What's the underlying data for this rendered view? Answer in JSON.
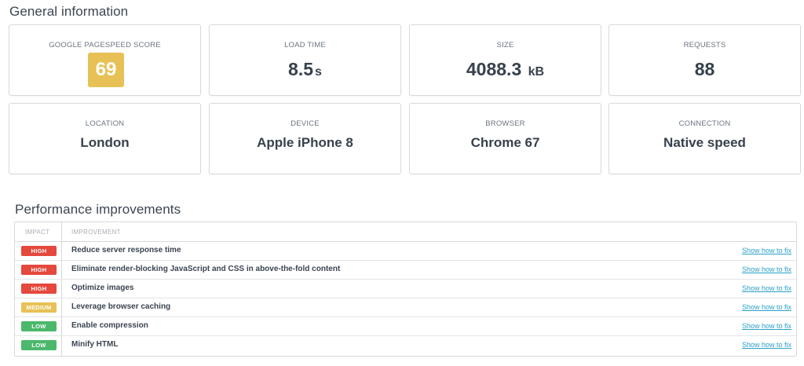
{
  "general": {
    "title": "General information",
    "cards": [
      {
        "label": "GOOGLE PAGESPEED SCORE",
        "value": "69",
        "badge_color": "#e8c156"
      },
      {
        "label": "LOAD TIME",
        "value": "8.5",
        "unit": "s"
      },
      {
        "label": "SIZE",
        "value": "4088.3",
        "unit": "kB"
      },
      {
        "label": "REQUESTS",
        "value": "88"
      },
      {
        "label": "LOCATION",
        "value": "London"
      },
      {
        "label": "DEVICE",
        "value": "Apple iPhone 8"
      },
      {
        "label": "BROWSER",
        "value": "Chrome 67"
      },
      {
        "label": "CONNECTION",
        "value": "Native speed"
      }
    ]
  },
  "performance": {
    "title": "Performance improvements",
    "columns": {
      "impact": "IMPACT",
      "improvement": "IMPROVEMENT"
    },
    "impact_colors": {
      "HIGH": "#e5483d",
      "MEDIUM": "#e8c156",
      "LOW": "#4cb86b"
    },
    "rows": [
      {
        "impact": "HIGH",
        "improvement": "Reduce server response time",
        "action": "Show how to fix"
      },
      {
        "impact": "HIGH",
        "improvement": "Eliminate render-blocking JavaScript and CSS in above-the-fold content",
        "action": "Show how to fix"
      },
      {
        "impact": "HIGH",
        "improvement": "Optimize images",
        "action": "Show how to fix"
      },
      {
        "impact": "MEDIUM",
        "improvement": "Leverage browser caching",
        "action": "Show how to fix"
      },
      {
        "impact": "LOW",
        "improvement": "Enable compression",
        "action": "Show how to fix"
      },
      {
        "impact": "LOW",
        "improvement": "Minify HTML",
        "action": "Show how to fix"
      }
    ]
  }
}
